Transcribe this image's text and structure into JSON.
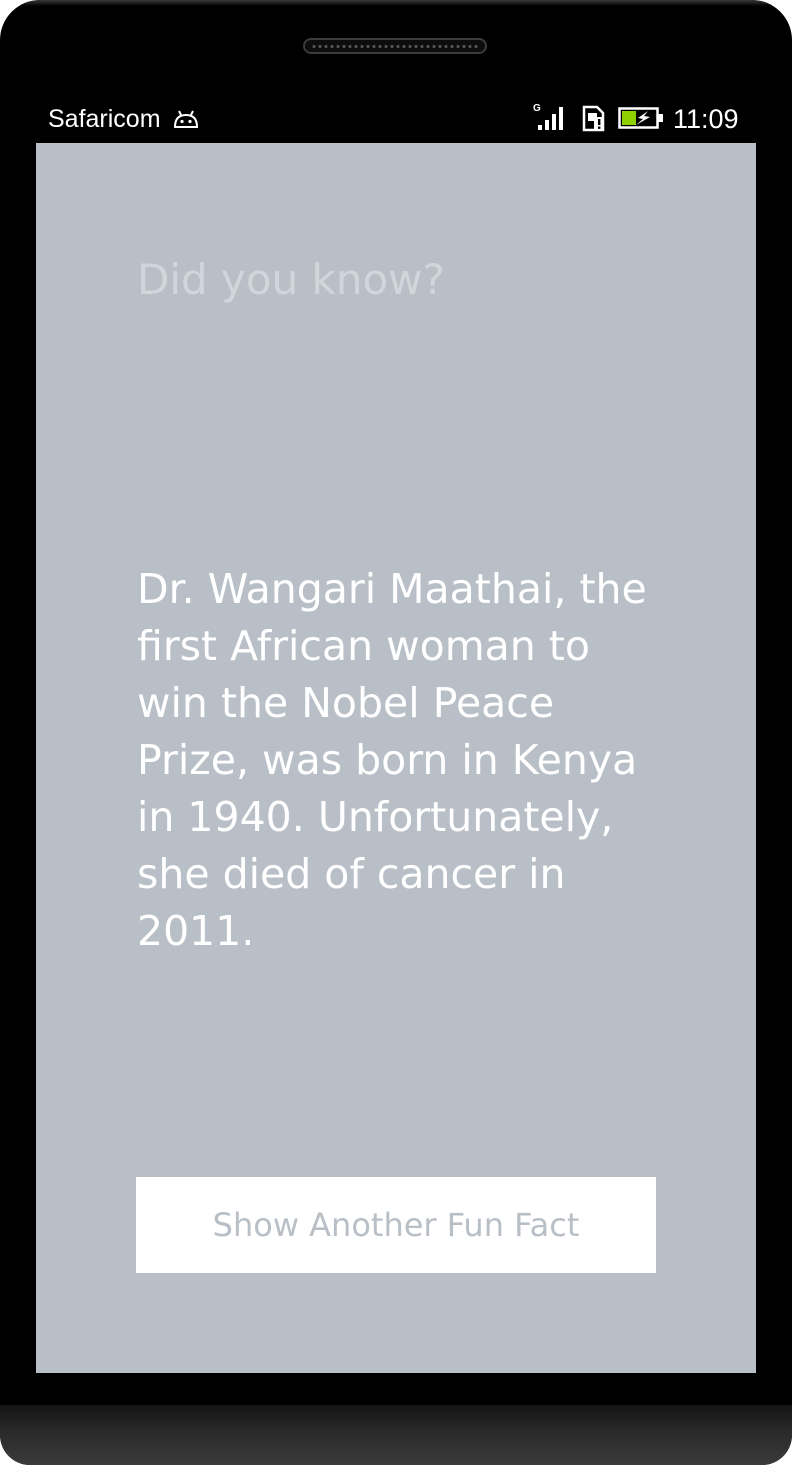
{
  "statusbar": {
    "carrier": "Safaricom",
    "time": "11:09",
    "network_type": "G",
    "icons": [
      "android-debug-icon",
      "signal-icon",
      "sim-alert-icon",
      "battery-charging-icon"
    ]
  },
  "main": {
    "headline": "Did you know?",
    "fact": "Dr. Wangari Maathai, the first African woman to win the Nobel Peace Prize, was born in Kenya in 1940. Unfortunately, she died of cancer in 2011.",
    "button_label": "Show Another Fun Fact"
  },
  "colors": {
    "screen_background": "#b8bfc6",
    "headline": "#d1d6db",
    "fact_text": "#ffffff",
    "button_background": "#ffffff",
    "button_text": "#b8bfc6",
    "battery_fill": "#8ed000"
  }
}
